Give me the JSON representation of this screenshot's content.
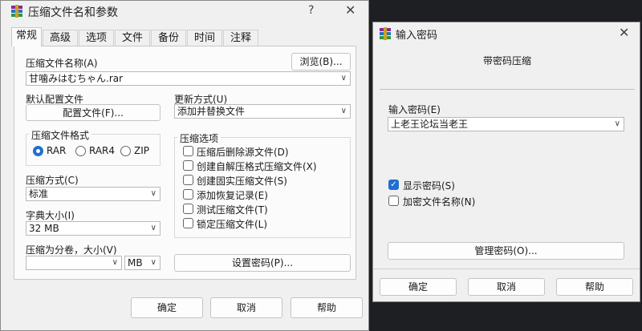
{
  "archive_dialog": {
    "title": "压缩文件名和参数",
    "help_icon": "?",
    "close_icon": "✕",
    "tabs": [
      "常规",
      "高级",
      "选项",
      "文件",
      "备份",
      "时间",
      "注释"
    ],
    "active_tab": "常规",
    "archive_name_label": "压缩文件名称(A)",
    "browse_button": "浏览(B)...",
    "archive_name_value": "甘噛みはむちゃん.rar",
    "default_profile_label": "默认配置文件",
    "profiles_button": "配置文件(F)...",
    "update_mode_label": "更新方式(U)",
    "update_mode_value": "添加并替换文件",
    "format_group_title": "压缩文件格式",
    "formats": [
      "RAR",
      "RAR4",
      "ZIP"
    ],
    "selected_format": "RAR",
    "options_group_title": "压缩选项",
    "options": [
      {
        "label": "压缩后删除源文件(D)",
        "checked": false
      },
      {
        "label": "创建自解压格式压缩文件(X)",
        "checked": false
      },
      {
        "label": "创建固实压缩文件(S)",
        "checked": false
      },
      {
        "label": "添加恢复记录(E)",
        "checked": false
      },
      {
        "label": "测试压缩文件(T)",
        "checked": false
      },
      {
        "label": "锁定压缩文件(L)",
        "checked": false
      }
    ],
    "method_label": "压缩方式(C)",
    "method_value": "标准",
    "dict_label": "字典大小(I)",
    "dict_value": "32 MB",
    "split_label": "压缩为分卷，大小(V)",
    "split_value": "",
    "split_unit": "MB",
    "set_password_button": "设置密码(P)...",
    "ok_button": "确定",
    "cancel_button": "取消",
    "help_button": "帮助"
  },
  "password_dialog": {
    "title": "输入密码",
    "close_icon": "✕",
    "subtitle": "带密码压缩",
    "password_label": "输入密码(E)",
    "password_value": "上老王论坛当老王",
    "show_password_label": "显示密码(S)",
    "show_password_checked": true,
    "encrypt_names_label": "加密文件名称(N)",
    "encrypt_names_checked": false,
    "manage_button": "管理密码(O)...",
    "ok_button": "确定",
    "cancel_button": "取消",
    "help_button": "帮助"
  }
}
